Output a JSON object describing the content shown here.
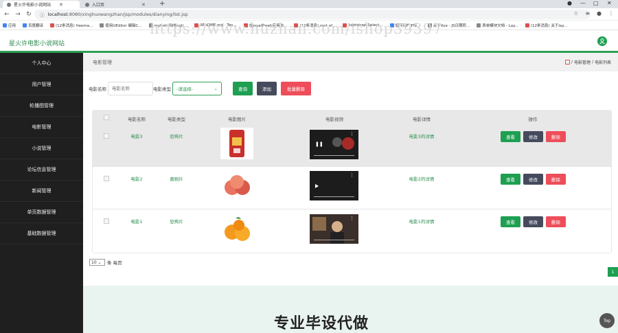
{
  "browser": {
    "tabs": [
      {
        "title": "星火许电影小说网站",
        "active": true
      },
      {
        "title": "入口页",
        "active": false
      }
    ],
    "url_host": "localhost",
    "url_path": ":8080/xinghuowangzhan/jsp/modules/dianying/list.jsp",
    "bookmarks": [
      "应用",
      "百度翻译",
      "(12条消息) freema...",
      "使用UEditor 编辑C...",
      "mybatis缺省sql(...",
      "README.md · Ten...",
      "在java中web应用中...",
      "(12条消息) root of...",
      "bootstrap-Select...",
      "如何用FTP传...",
      "关于Vue - JS日期转...",
      "表单模块文档 - Lay...",
      "(12条消息) 关于lay..."
    ]
  },
  "watermark": "https://www.huzhan.com/ishop39397",
  "site": {
    "title": "星火许电影小说网站"
  },
  "sidebar": {
    "items": [
      "个人中心",
      "用户管理",
      "轮播图管理",
      "电影管理",
      "小说管理",
      "论坛信息管理",
      "新闻管理",
      "单页数据管理",
      "基础数据管理"
    ]
  },
  "breadcrumb": {
    "title": "电影管理",
    "path1": "电影管理",
    "sep": "/",
    "path2": "电影列表"
  },
  "search": {
    "name_label": "电影名称",
    "name_placeholder": "电影名称",
    "type_label": "电影类型",
    "type_selected": "-请选择-",
    "query_button": "查询",
    "add_button": "添加",
    "batch_delete_button": "批量删除"
  },
  "table": {
    "headers": [
      "电影名称",
      "电影类型",
      "电影图片",
      "电影视频",
      "电影详情",
      "操作"
    ],
    "rows": [
      {
        "name": "电影3",
        "type": "恐怖片",
        "detail": "电影3的详情",
        "image": "rice-bag-image",
        "video": "video-player-dark"
      },
      {
        "name": "电影2",
        "type": "喜剧片",
        "detail": "电影2的详情",
        "image": "apples-image",
        "video": "video-player"
      },
      {
        "name": "电影1",
        "type": "恐怖片",
        "detail": "电影1的详情",
        "image": "oranges-image",
        "video": "video-player-room"
      }
    ],
    "view_label": "查看",
    "edit_label": "修改",
    "delete_label": "删除"
  },
  "pagination": {
    "page_size": "10",
    "per_page_label": "条 每页",
    "current_page": "1"
  },
  "footer": {
    "text": "专业毕设代做",
    "top_button": "Top"
  },
  "colors": {
    "accent": "#1e9f51",
    "sidebar": "#1f1f1f",
    "danger": "#ee4d5a",
    "dark_button": "#454a5c"
  }
}
